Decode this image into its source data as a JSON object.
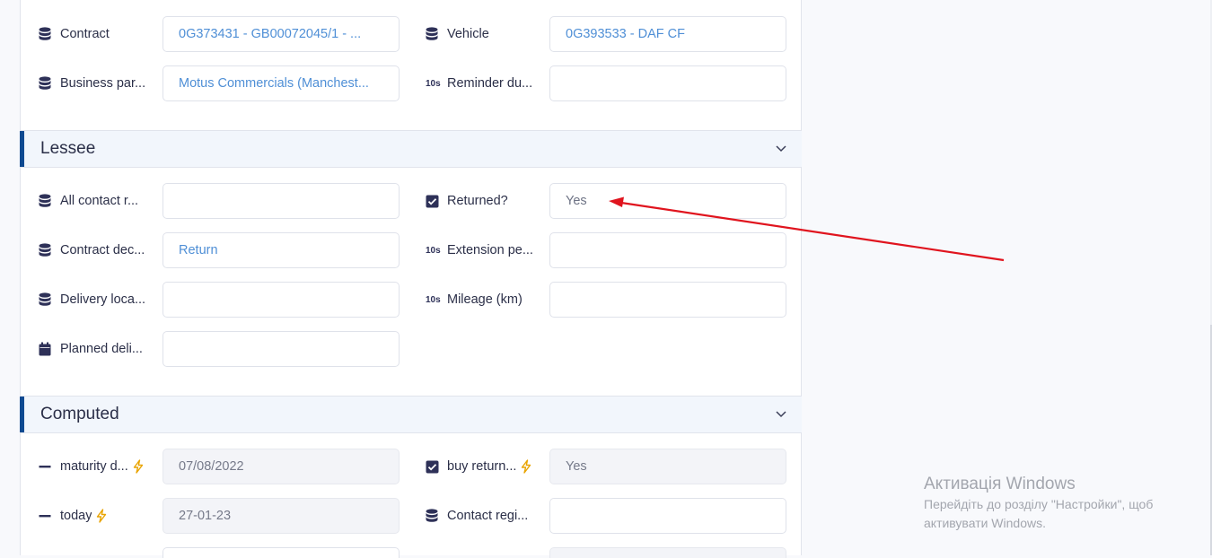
{
  "general": {
    "contract_label": "Contract",
    "contract_value": "0G373431 - GB00072045/1 - ...",
    "vehicle_label": "Vehicle",
    "vehicle_value": "0G393533 - DAF CF",
    "business_partner_label": "Business par...",
    "business_partner_value": "Motus Commercials (Manchest...",
    "reminder_label": "Reminder du...",
    "reminder_value": ""
  },
  "lessee": {
    "title": "Lessee",
    "all_contact_label": "All contact r...",
    "all_contact_value": "",
    "returned_label": "Returned?",
    "returned_value": "Yes",
    "contract_decision_label": "Contract dec...",
    "contract_decision_value": "Return",
    "extension_label": "Extension pe...",
    "extension_value": "",
    "delivery_location_label": "Delivery loca...",
    "delivery_location_value": "",
    "mileage_label": "Mileage (km)",
    "mileage_value": "",
    "planned_delivery_label": "Planned deli...",
    "planned_delivery_value": ""
  },
  "computed": {
    "title": "Computed",
    "maturity_label": "maturity d...",
    "maturity_value": "07/08/2022",
    "buy_return_label": "buy return...",
    "buy_return_value": "Yes",
    "today_label": "today",
    "today_value": "27-01-23",
    "contact_reg_label": "Contact regi...",
    "contact_reg_value": ""
  },
  "icons": {
    "number_glyph": "10s"
  },
  "windows_notice": {
    "heading": "Активація Windows",
    "line1": "Перейдіть до розділу \"Настройки\", щоб",
    "line2": "активувати Windows."
  },
  "colors": {
    "accent_bar": "#0e4a91",
    "link": "#4f8fd6",
    "annotation_arrow": "#e0141e",
    "bolt": "#e9a400"
  }
}
